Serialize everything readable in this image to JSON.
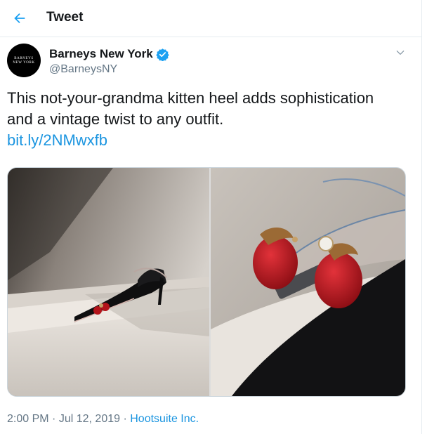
{
  "header": {
    "title": "Tweet",
    "back_icon": "back-arrow-icon"
  },
  "author": {
    "display_name": "Barneys New York",
    "handle": "@BarneysNY",
    "avatar_line1": "BARNEYS",
    "avatar_line2": "NEW YORK",
    "verified_icon": "verified-badge-icon"
  },
  "tweet": {
    "text": "This not-your-grandma kitten heel adds sophistication and a vintage twist to any outfit.",
    "link": "bit.ly/2NMwxfb"
  },
  "meta": {
    "time": "2:00 PM",
    "date": "Jul 12, 2019",
    "separator": "·",
    "source": "Hootsuite Inc."
  },
  "colors": {
    "link": "#1b95e0",
    "verified": "#1da1f2",
    "secondary_text": "#657786",
    "border": "#e6ecf0"
  }
}
